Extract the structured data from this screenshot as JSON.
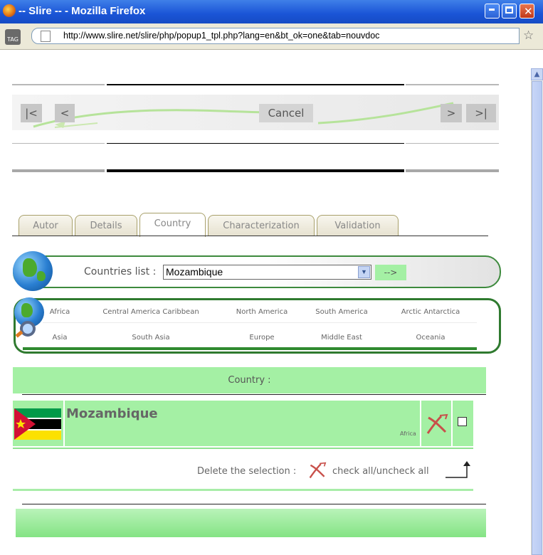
{
  "window": {
    "title": "-- Slire -- - Mozilla Firefox",
    "controls": [
      "minimize-icon",
      "maximize-icon",
      "close-icon"
    ]
  },
  "addressbar": {
    "tag_label": "TAG",
    "url": "http://www.slire.net/slire/php/popup1_tpl.php?lang=en&bt_ok=one&tab=nouvdoc"
  },
  "nav": {
    "first": "|<",
    "prev": "<",
    "cancel": "Cancel",
    "next": ">",
    "last": ">|"
  },
  "tabs": [
    {
      "label": "Autor",
      "active": false
    },
    {
      "label": "Details",
      "active": false
    },
    {
      "label": "Country",
      "active": true
    },
    {
      "label": "Characterization",
      "active": false
    },
    {
      "label": "Validation",
      "active": false
    }
  ],
  "countries": {
    "label": "Countries list :",
    "selected": "Mozambique",
    "go_label": "-->"
  },
  "regions": {
    "row1": [
      "Africa",
      "Central America Caribbean",
      "North America",
      "South America",
      "Arctic Antarctica"
    ],
    "row2": [
      "Asia",
      "South Asia",
      "Europe",
      "Middle East",
      "Oceania"
    ]
  },
  "table": {
    "header": "Country :",
    "rows": [
      {
        "name": "Mozambique",
        "region": "Africa"
      }
    ]
  },
  "actions": {
    "delete_label": "Delete the selection :",
    "check_all": "check all/uncheck all"
  },
  "colors": {
    "titlebar": "#1a54d6",
    "accent_green": "#a4f0a4",
    "border_green": "#2f7a2f",
    "delete_red": "#c8504a"
  }
}
